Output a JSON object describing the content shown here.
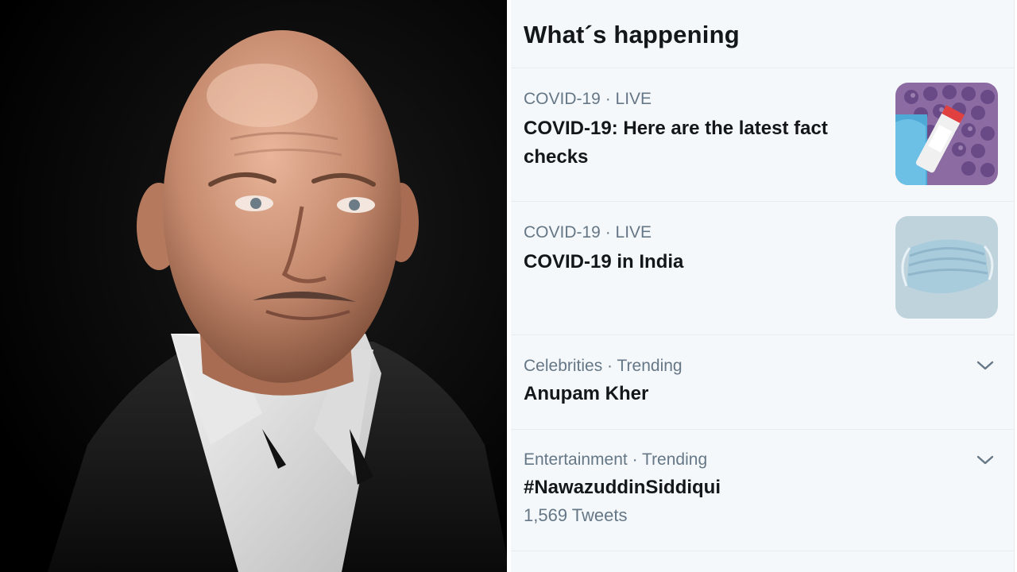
{
  "photo": {
    "icon": "portrait-photo"
  },
  "panel": {
    "title": "What´s happening",
    "trends": [
      {
        "category": "COVID-19",
        "tag": "LIVE",
        "meta": "COVID-19 · LIVE",
        "name": "COVID-19: Here are the latest fact checks",
        "icon": "virus-test-tubes-thumbnail"
      },
      {
        "category": "COVID-19",
        "tag": "LIVE",
        "meta": "COVID-19 · LIVE",
        "name": "COVID-19 in India",
        "icon": "face-mask-thumbnail"
      },
      {
        "category": "Celebrities",
        "tag": "Trending",
        "meta": "Celebrities · Trending",
        "name": "Anupam Kher",
        "icon": "chevron-down-icon"
      },
      {
        "category": "Entertainment",
        "tag": "Trending",
        "meta": "Entertainment · Trending",
        "name": "#NawazuddinSiddiqui",
        "count": "1,569 Tweets",
        "icon": "chevron-down-icon"
      }
    ]
  },
  "colors": {
    "panel_bg": "#f5f8fa",
    "text_primary": "#14171a",
    "text_secondary": "#657786",
    "border": "#e6ecf0"
  }
}
